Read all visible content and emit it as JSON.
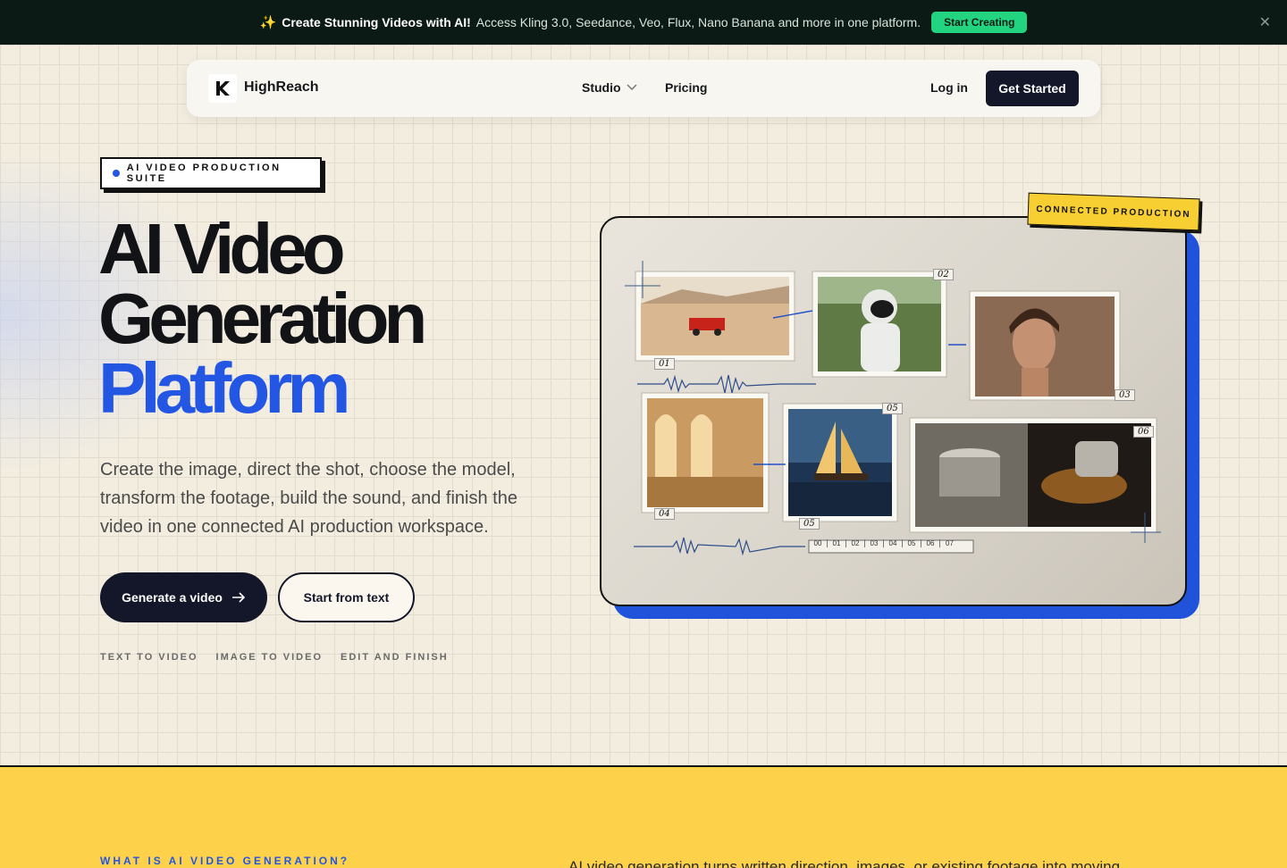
{
  "announcement": {
    "sparkle": "✨",
    "headline": "Create Stunning Videos with AI!",
    "text": "Access Kling 3.0, Seedance, Veo, Flux, Nano Banana and more in one platform.",
    "cta": "Start Creating",
    "close_icon": "close-icon"
  },
  "nav": {
    "brand": "HighReach",
    "studio": "Studio",
    "pricing": "Pricing",
    "login": "Log in",
    "get_started": "Get Started"
  },
  "hero": {
    "badge": "AI VIDEO PRODUCTION SUITE",
    "title_line1": "AI Video",
    "title_line2": "Generation",
    "title_line3": "Platform",
    "lead": "Create the image, direct the shot, choose the model, transform the footage, build the sound, and finish the video in one connected AI production workspace.",
    "primary_button": "Generate a video",
    "secondary_button": "Start from text",
    "tags": [
      "TEXT TO VIDEO",
      "IMAGE TO VIDEO",
      "EDIT AND FINISH"
    ]
  },
  "visual": {
    "badge": "CONNECTED PRODUCTION",
    "frame_labels": [
      "01",
      "02",
      "03",
      "04",
      "05",
      "05",
      "06"
    ],
    "timeline": [
      "00",
      "01",
      "02",
      "03",
      "04",
      "05",
      "06",
      "07"
    ]
  },
  "section": {
    "eyebrow": "WHAT IS AI VIDEO GENERATION?",
    "intro": "AI video generation turns written direction, images, or existing footage into moving"
  },
  "colors": {
    "accent_blue": "#2356e3",
    "yellow": "#fdd24a",
    "dark": "#14172a",
    "green_cta": "#22d37f"
  }
}
